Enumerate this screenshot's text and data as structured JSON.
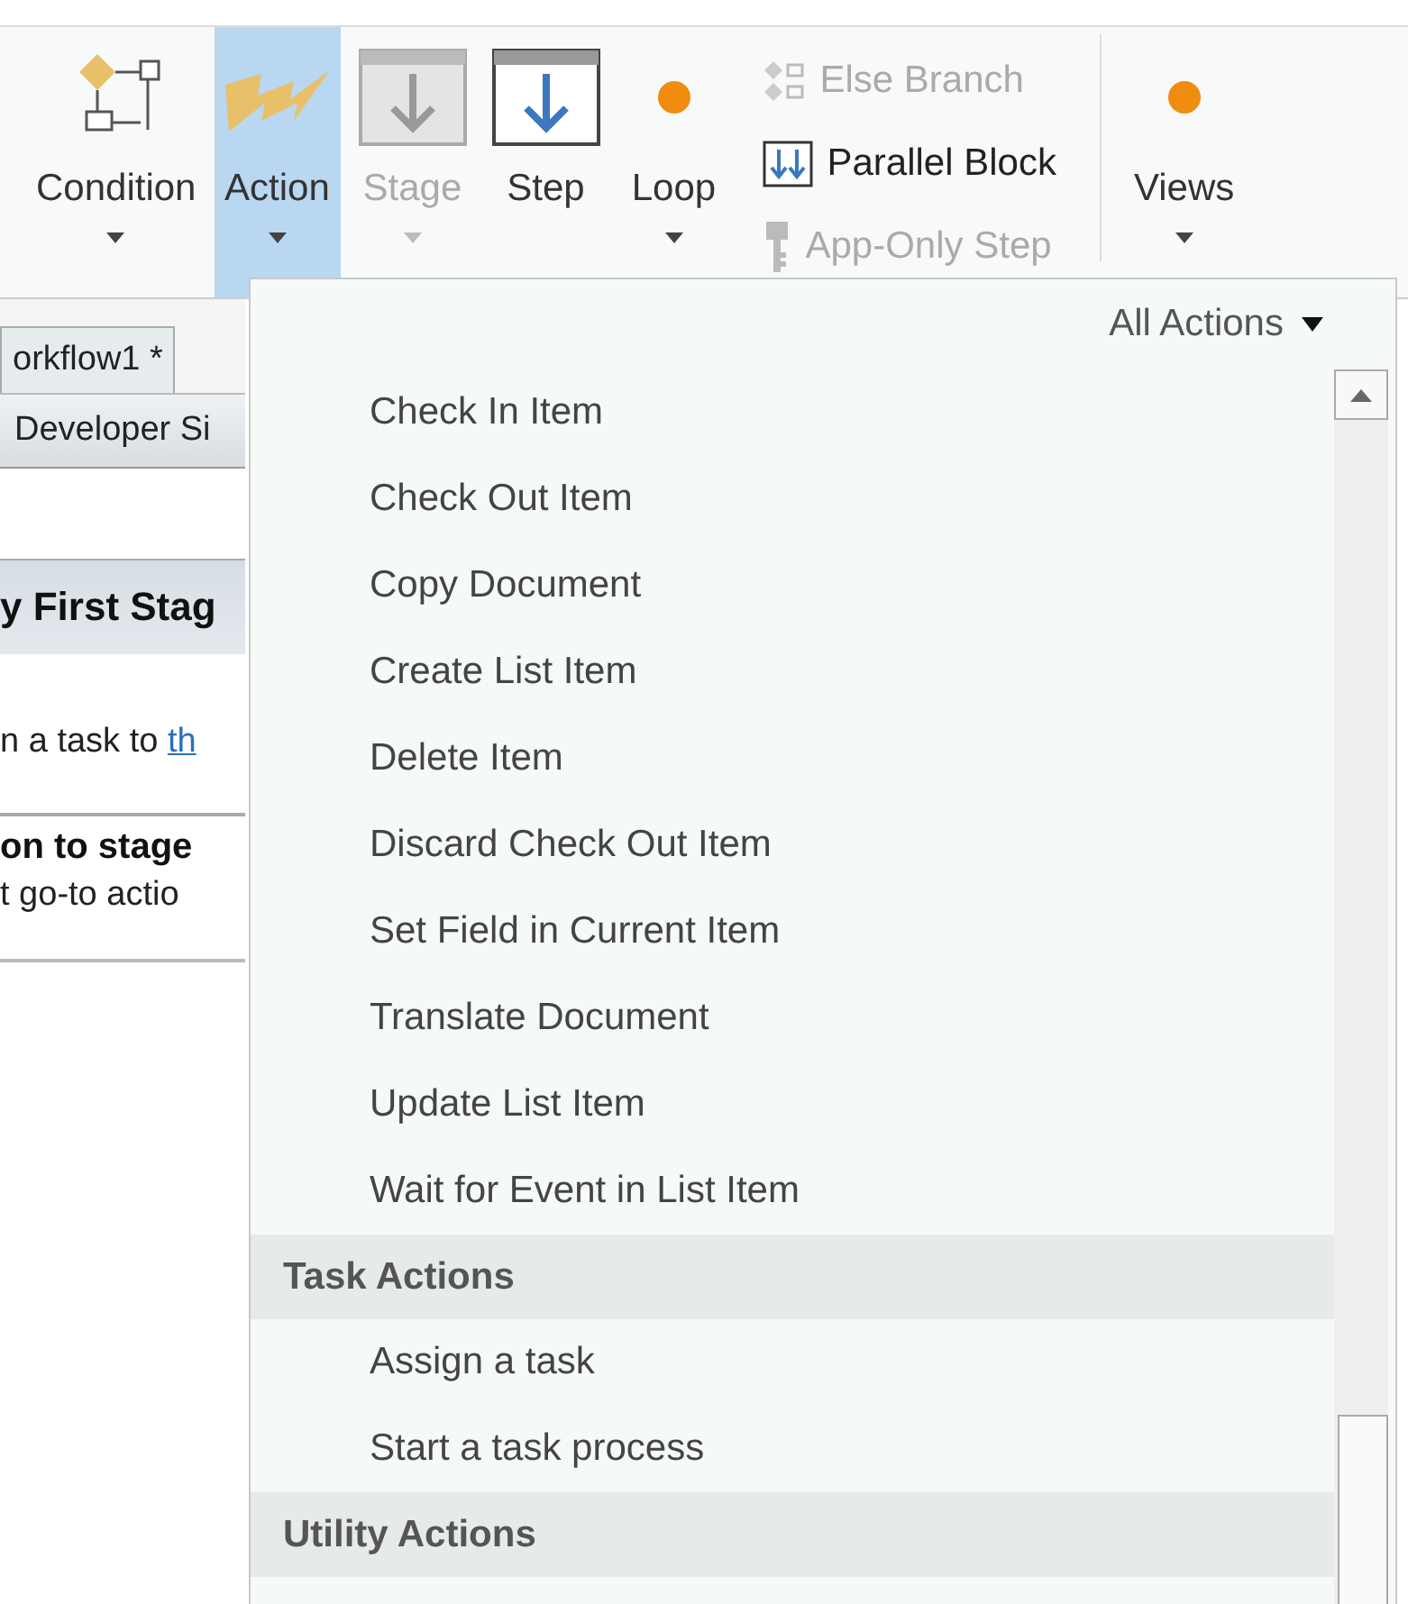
{
  "ribbon": {
    "buttons": [
      {
        "label": "Condition",
        "kind": "large",
        "selected": false,
        "disabled": false,
        "dropdown": true
      },
      {
        "label": "Action",
        "kind": "large",
        "selected": true,
        "disabled": false,
        "dropdown": true
      },
      {
        "label": "Stage",
        "kind": "large",
        "selected": false,
        "disabled": true,
        "dropdown": true
      },
      {
        "label": "Step",
        "kind": "large",
        "selected": false,
        "disabled": false,
        "dropdown": false
      },
      {
        "label": "Loop",
        "kind": "large",
        "selected": false,
        "disabled": false,
        "dropdown": true
      },
      {
        "kind": "stack",
        "items": [
          {
            "label": "Else Branch",
            "disabled": true
          },
          {
            "label": "Parallel Block",
            "disabled": false
          },
          {
            "label": "App-Only Step",
            "disabled": true
          }
        ]
      },
      {
        "kind": "separator"
      },
      {
        "label": "Views",
        "kind": "large",
        "selected": false,
        "disabled": false,
        "dropdown": true
      }
    ]
  },
  "document": {
    "tab": "orkflow1 *",
    "breadcrumb": "Developer Si",
    "stage_title": "y First Stag",
    "step_text": "n a task to ",
    "step_link": "th",
    "transition_title": "on to stage",
    "transition_text": "t go-to actio"
  },
  "menu": {
    "filter": "All Actions",
    "items": [
      {
        "kind": "item",
        "label": "Check In Item"
      },
      {
        "kind": "item",
        "label": "Check Out Item"
      },
      {
        "kind": "item",
        "label": "Copy Document"
      },
      {
        "kind": "item",
        "label": "Create List Item"
      },
      {
        "kind": "item",
        "label": "Delete Item"
      },
      {
        "kind": "item",
        "label": "Discard Check Out Item"
      },
      {
        "kind": "item",
        "label": "Set Field in Current Item"
      },
      {
        "kind": "item",
        "label": "Translate Document"
      },
      {
        "kind": "item",
        "label": "Update List Item"
      },
      {
        "kind": "item",
        "label": "Wait for Event in List Item"
      },
      {
        "kind": "section",
        "label": "Task Actions"
      },
      {
        "kind": "item",
        "label": "Assign a task"
      },
      {
        "kind": "item",
        "label": "Start a task process"
      },
      {
        "kind": "section",
        "label": "Utility Actions"
      }
    ]
  }
}
